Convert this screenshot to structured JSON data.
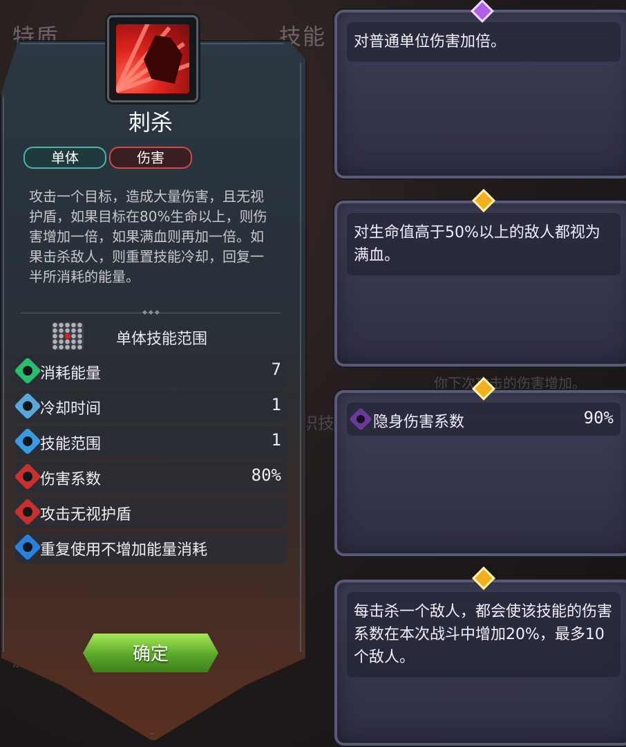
{
  "background": {
    "tab_traits": "特质",
    "tab_skills": "技能",
    "obscured_hint": "你下次攻击的伤害增加。",
    "obscured_side": "识技",
    "obscured_bottom": "加"
  },
  "skill": {
    "name": "刺杀",
    "tags": [
      "单体",
      "伤害"
    ],
    "description": "攻击一个目标，造成大量伤害，且无视护盾，如果目标在80%生命以上，则伤害增加一倍，如果满血则再加一倍。如果击杀敌人，则重置技能冷却，回复一半所消耗的能量。",
    "range_label": "单体技能范围",
    "stats": [
      {
        "icon": "energy-icon",
        "label": "消耗能量",
        "value": "7",
        "color": "#28c070"
      },
      {
        "icon": "cooldown-icon",
        "label": "冷却时间",
        "value": "1",
        "color": "#5aa8d8"
      },
      {
        "icon": "range-icon",
        "label": "技能范围",
        "value": "1",
        "color": "#3a9ae0"
      },
      {
        "icon": "damage-icon",
        "label": "伤害系数",
        "value": "80%",
        "color": "#c83030"
      },
      {
        "icon": "pierce-shield-icon",
        "label": "攻击无视护盾",
        "value": "",
        "color": "#c83030"
      },
      {
        "icon": "repeat-icon",
        "label": "重复使用不增加能量消耗",
        "value": "",
        "color": "#2a80e0"
      }
    ],
    "confirm_label": "确定"
  },
  "cards": [
    {
      "gem": "purple",
      "text": "对普通单位伤害加倍。"
    },
    {
      "gem": "gold",
      "text": "对生命值高于50%以上的敌人都视为满血。"
    },
    {
      "gem": "gold",
      "stat_label": "隐身伤害系数",
      "stat_value": "90%"
    },
    {
      "gem": "gold",
      "text": "每击杀一个敌人，都会使该技能的伤害系数在本次战斗中增加20%，最多10个敌人。"
    }
  ]
}
